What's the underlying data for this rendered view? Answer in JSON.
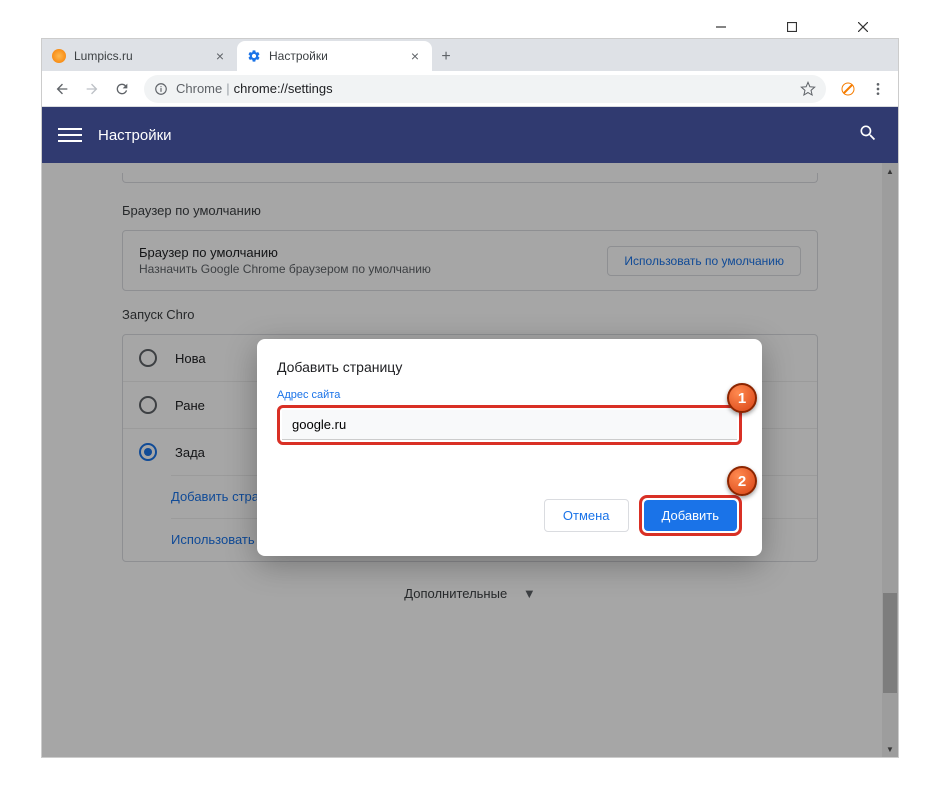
{
  "window": {
    "tab1_title": "Lumpics.ru",
    "tab2_title": "Настройки"
  },
  "toolbar": {
    "omnibox_host": "Chrome",
    "omnibox_path": "chrome://settings"
  },
  "header": {
    "title": "Настройки"
  },
  "default_browser": {
    "section_title": "Браузер по умолчанию",
    "row_title": "Браузер по умолчанию",
    "row_subtitle": "Назначить Google Chrome браузером по умолчанию",
    "button": "Использовать по умолчанию"
  },
  "startup": {
    "section_title": "Запуск Chro",
    "opt1": "Нова",
    "opt2": "Ране",
    "opt3": "Зада",
    "add_page": "Добавить страницу",
    "use_current": "Использовать текущие страницы"
  },
  "advanced": "Дополнительные",
  "dialog": {
    "title": "Добавить страницу",
    "label": "Адрес сайта",
    "value": "google.ru",
    "cancel": "Отмена",
    "add": "Добавить"
  },
  "markers": {
    "m1": "1",
    "m2": "2"
  }
}
